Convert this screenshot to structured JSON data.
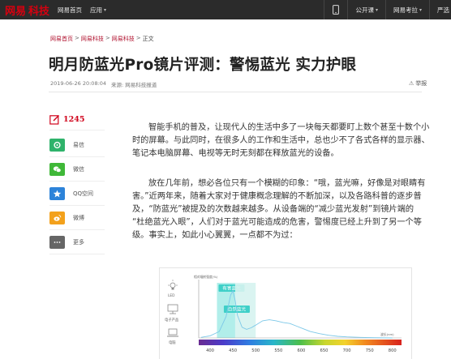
{
  "topbar": {
    "site_name": "网易",
    "channel_name": "科技",
    "links": [
      {
        "label": "网易首页",
        "caret": ""
      },
      {
        "label": "应用",
        "caret": "▾"
      }
    ],
    "right_links": [
      {
        "label": "公开课",
        "caret": "▾"
      },
      {
        "label": "网易考拉",
        "caret": "▾"
      },
      {
        "label": "严选",
        "caret": ""
      }
    ],
    "icons": {
      "phone": "phone-icon"
    },
    "colors": {
      "bar": "#2b2b2b",
      "brand_red": "#d8000f"
    }
  },
  "breadcrumb": {
    "items": [
      "网易首页",
      "网易科技",
      "网易科技"
    ],
    "separator": ">",
    "current": "正文"
  },
  "article": {
    "title": "明月防蓝光Pro镜片评测：警惕蓝光 实力护眼",
    "date": "2019-06-26 20:08:04",
    "source": "来源: 网易科技报道",
    "report_label": "举报",
    "paragraphs": [
      [
        "智能手机的普及，让现代人的生活中多了一块每天都要盯上数个甚至十数个小",
        "时的屏幕。与此同时，在很多人的工作和生活中，总也少不了各式各样的显示器、",
        "笔记本电脑屏幕、电视等无时无刻都在释放蓝光的设备。"
      ],
      [
        "放在几年前，想必各位只有一个模糊的印象：“哦，蓝光嘛，好像是对眼睛有",
        "害。”近两年来，随着大家对于健康概念理解的不断加深，以及各路科普的逐步普",
        "及，“防蓝光”被提及的次数越来越多。从设备端的“减少蓝光发射”到镜片端的",
        "“杜绝蓝光入眼”，人们对于蓝光可能造成的危害，警惕度已经上升到了另一个等",
        "级。事实上，如此小心翼翼，一点都不为过："
      ]
    ]
  },
  "share": {
    "comment_count": "1245",
    "items": [
      {
        "label": "易信",
        "icon": "yixin-icon",
        "color": "#2fb36b"
      },
      {
        "label": "微信",
        "icon": "wechat-icon",
        "color": "#3fb838"
      },
      {
        "label": "QQ空间",
        "icon": "qzone-icon",
        "color": "#2d83d9"
      },
      {
        "label": "微博",
        "icon": "weibo-icon",
        "color": "#f3a11c"
      },
      {
        "label": "更多",
        "icon": "more-icon",
        "color": "#666666"
      }
    ]
  },
  "figure": {
    "devices": [
      {
        "label": "LED",
        "icon": "bulb-icon"
      },
      {
        "label": "电子产品",
        "icon": "monitor-icon"
      },
      {
        "label": "电脑",
        "icon": "laptop-icon"
      }
    ],
    "chart_data": {
      "type": "line",
      "ylabel": "相对辐射强度(%)",
      "xlabel": "波长(nm)",
      "x_ticks": [
        400,
        450,
        500,
        550,
        600,
        650,
        700,
        750,
        800
      ],
      "xlim": [
        375,
        820
      ],
      "ylim": [
        0,
        100
      ],
      "bands": [
        {
          "label": "有害蓝光",
          "x_range": [
            415,
            455
          ],
          "color": "#a8ece8"
        },
        {
          "label": "自然蓝光",
          "x_range": [
            455,
            500
          ],
          "color": "#d6f3f0"
        }
      ],
      "series": [
        {
          "x": [
            380,
            400,
            420,
            435,
            445,
            450,
            455,
            460,
            470,
            480,
            490,
            500,
            515,
            530,
            545,
            560,
            575,
            590,
            605,
            620,
            640,
            660,
            680,
            700,
            730,
            760,
            800
          ],
          "y": [
            1,
            4,
            12,
            40,
            80,
            88,
            70,
            42,
            20,
            16,
            19,
            24,
            32,
            34,
            32,
            29,
            27,
            22,
            17,
            12,
            8,
            5,
            3,
            2,
            1,
            0.5,
            0
          ]
        }
      ],
      "grid": false,
      "colorbar": "visible-spectrum gradient under x axis"
    }
  }
}
